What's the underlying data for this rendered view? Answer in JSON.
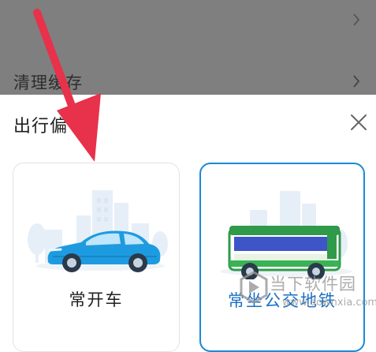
{
  "background_list": {
    "items": [
      {
        "label": "",
        "icon": "chevron-right-icon"
      },
      {
        "label": "清理缓存",
        "icon": "chevron-right-icon"
      }
    ]
  },
  "sheet": {
    "title": "出行偏",
    "close_icon": "close-icon",
    "options": [
      {
        "label": "常开车",
        "icon": "car-illustration",
        "selected": false
      },
      {
        "label": "常坐公交地铁",
        "icon": "bus-illustration",
        "selected": true
      }
    ]
  },
  "watermark": {
    "text": "当下软件园",
    "url": "www.downxia.com"
  },
  "colors": {
    "accent": "#1a8ad6",
    "overlay": "#7f7f7f",
    "arrow": "#e8314a"
  }
}
